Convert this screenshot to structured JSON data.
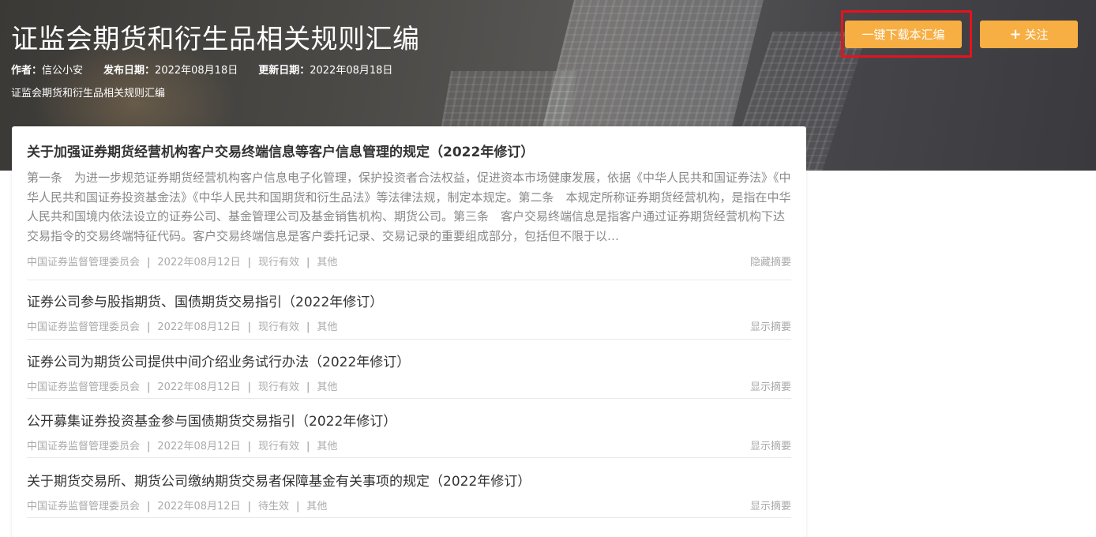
{
  "header": {
    "title": "证监会期货和衍生品相关规则汇编",
    "author_label": "作者：",
    "author": "信公小安",
    "publish_label": "发布日期：",
    "publish_date": "2022年08月18日",
    "update_label": "更新日期：",
    "update_date": "2022年08月18日",
    "subtitle": "证监会期货和衍生品相关规则汇编",
    "download_button": "一键下载本汇编",
    "follow_button": "关注",
    "follow_icon": "plus-icon"
  },
  "colors": {
    "accent": "#f7ae42",
    "highlight_box": "#e8121c"
  },
  "items": [
    {
      "title": "关于加强证券期货经营机构客户交易终端信息等客户信息管理的规定（2022年修订）",
      "summary": "第一条　为进一步规范证券期货经营机构客户信息电子化管理，保护投资者合法权益，促进资本市场健康发展，依据《中华人民共和国证券法》《中华人民共和国证券投资基金法》《中华人民共和国期货和衍生品法》等法律法规，制定本规定。第二条　本规定所称证券期货经营机构，是指在中华人民共和国境内依法设立的证券公司、基金管理公司及基金销售机构、期货公司。第三条　客户交易终端信息是指客户通过证券期货经营机构下达交易指令的交易终端特征代码。客户交易终端信息是客户委托记录、交易记录的重要组成部分，包括但不限于以…",
      "publisher": "中国证券监督管理委员会",
      "date": "2022年08月12日",
      "status": "现行有效",
      "category": "其他",
      "toggle": "隐藏摘要"
    },
    {
      "title": "证券公司参与股指期货、国债期货交易指引（2022年修订）",
      "publisher": "中国证券监督管理委员会",
      "date": "2022年08月12日",
      "status": "现行有效",
      "category": "其他",
      "toggle": "显示摘要"
    },
    {
      "title": "证券公司为期货公司提供中间介绍业务试行办法（2022年修订）",
      "publisher": "中国证券监督管理委员会",
      "date": "2022年08月12日",
      "status": "现行有效",
      "category": "其他",
      "toggle": "显示摘要"
    },
    {
      "title": "公开募集证券投资基金参与国债期货交易指引（2022年修订）",
      "publisher": "中国证券监督管理委员会",
      "date": "2022年08月12日",
      "status": "现行有效",
      "category": "其他",
      "toggle": "显示摘要"
    },
    {
      "title": "关于期货交易所、期货公司缴纳期货交易者保障基金有关事项的规定（2022年修订）",
      "publisher": "中国证券监督管理委员会",
      "date": "2022年08月12日",
      "status": "待生效",
      "category": "其他",
      "toggle": "显示摘要"
    }
  ],
  "separator": "|"
}
